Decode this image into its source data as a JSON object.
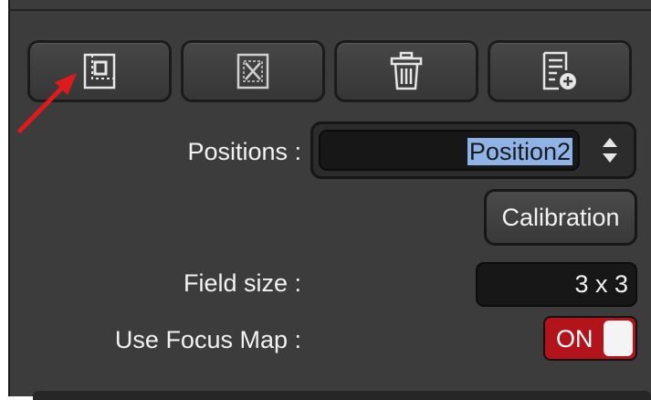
{
  "toolbar": {
    "buttons": [
      {
        "name": "select-region-button",
        "icon": "select-region-icon"
      },
      {
        "name": "clear-region-button",
        "icon": "clear-region-icon"
      },
      {
        "name": "delete-button",
        "icon": "trash-icon"
      },
      {
        "name": "add-to-list-button",
        "icon": "list-add-icon"
      }
    ]
  },
  "positions": {
    "label": "Positions :",
    "value": "Position2"
  },
  "calibration": {
    "label": "Calibration"
  },
  "field_size": {
    "label": "Field size :",
    "value": "3 x 3"
  },
  "focus_map": {
    "label": "Use Focus Map :",
    "state": "ON"
  },
  "colors": {
    "panel_bg": "#3c3c3c",
    "toggle_on": "#b3131a",
    "selection": "#8fb3e6",
    "annotation_arrow": "#e0191d"
  }
}
